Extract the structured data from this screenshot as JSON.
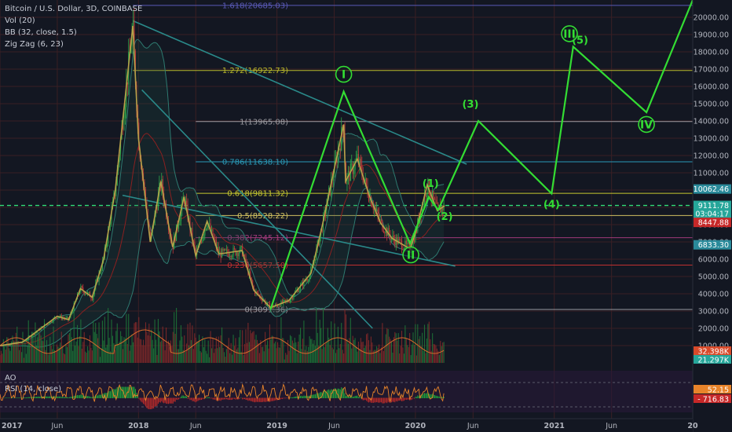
{
  "legend": {
    "title": "Bitcoin / U.S. Dollar, 3D, COINBASE",
    "vol": "Vol (20)",
    "bb": "BB (32, close, 1.5)",
    "zigzag": "Zig Zag (6, 23)"
  },
  "indicators": {
    "ao": "AO",
    "rsi": "RSI (14, close)"
  },
  "colors": {
    "background": "#131722",
    "grid": "#3a1f24",
    "wave": "#33dd33",
    "trend": "#2a8a8a",
    "bb": "#2e7a70",
    "ma": "#8b2020",
    "zigzag": "#b7a24a",
    "up": "#26a69a",
    "down": "#ef5350",
    "current": "#33dd77",
    "rsi": "#e8842a",
    "axis_text": "#b2b5be"
  },
  "chart_data": {
    "type": "candlestick",
    "symbol": "Bitcoin / U.S. Dollar",
    "interval": "3D",
    "exchange": "COINBASE",
    "price_axis": {
      "min": 0,
      "max": 21000,
      "ticks": [
        "1000.00",
        "2000.00",
        "3000.00",
        "4000.00",
        "5000.00",
        "6000.00",
        "7000.00",
        "8000.00",
        "9000.00",
        "10000.00",
        "11000.00",
        "12000.00",
        "13000.00",
        "14000.00",
        "15000.00",
        "16000.00",
        "17000.00",
        "18000.00",
        "19000.00",
        "20000.00"
      ]
    },
    "time_axis": {
      "start": "2017-01",
      "end": "2022-01",
      "ticks": [
        {
          "label": "2017",
          "date": "2017-01"
        },
        {
          "label": "Jun",
          "date": "2017-06"
        },
        {
          "label": "2018",
          "date": "2018-01"
        },
        {
          "label": "Jun",
          "date": "2018-06"
        },
        {
          "label": "2019",
          "date": "2019-01"
        },
        {
          "label": "Jun",
          "date": "2019-06"
        },
        {
          "label": "2020",
          "date": "2020-01"
        },
        {
          "label": "Jun",
          "date": "2020-06"
        },
        {
          "label": "2021",
          "date": "2021-01"
        },
        {
          "label": "Jun",
          "date": "2021-06"
        },
        {
          "label": "20",
          "date": "2022-01"
        }
      ]
    },
    "price_path": [
      [
        "2017-01",
        1000
      ],
      [
        "2017-03",
        1200
      ],
      [
        "2017-05",
        2200
      ],
      [
        "2017-06",
        2700
      ],
      [
        "2017-07",
        2500
      ],
      [
        "2017-08",
        4300
      ],
      [
        "2017-09",
        3800
      ],
      [
        "2017-10",
        6000
      ],
      [
        "2017-11",
        10000
      ],
      [
        "2017-12-17",
        19500
      ],
      [
        "2018-01",
        13000
      ],
      [
        "2018-02",
        7000
      ],
      [
        "2018-03",
        10500
      ],
      [
        "2018-04",
        6700
      ],
      [
        "2018-05",
        9600
      ],
      [
        "2018-06",
        6200
      ],
      [
        "2018-07",
        8200
      ],
      [
        "2018-08",
        6300
      ],
      [
        "2018-10",
        6500
      ],
      [
        "2018-11",
        4200
      ],
      [
        "2018-12-15",
        3200
      ],
      [
        "2019-02",
        3600
      ],
      [
        "2019-04",
        5200
      ],
      [
        "2019-05",
        8000
      ],
      [
        "2019-06-26",
        13800
      ],
      [
        "2019-07",
        10500
      ],
      [
        "2019-08",
        11800
      ],
      [
        "2019-09",
        9700
      ],
      [
        "2019-10",
        8100
      ],
      [
        "2019-11",
        7200
      ],
      [
        "2019-12-18",
        6600
      ],
      [
        "2020-01",
        7500
      ],
      [
        "2020-02",
        10300
      ],
      [
        "2020-02-28",
        8800
      ],
      [
        "2020-03-18",
        9100
      ]
    ],
    "fib_levels": [
      {
        "label": "1.618(20685.03)",
        "price": 20685.03,
        "color": "#5a5ab8"
      },
      {
        "label": "1.272(16922.73)",
        "price": 16922.73,
        "color": "#b8b82a"
      },
      {
        "label": "1(13965.08)",
        "price": 13965.08,
        "color": "#9a9aa0"
      },
      {
        "label": "0.786(11638.10)",
        "price": 11638.1,
        "color": "#2a9ab8"
      },
      {
        "label": "0.618(9811.32)",
        "price": 9811.32,
        "color": "#c8c830"
      },
      {
        "label": "0.5(8528.22)",
        "price": 8528.22,
        "color": "#d0c060"
      },
      {
        "label": "0.382(7245.12)",
        "price": 7245.12,
        "color": "#a03a7a"
      },
      {
        "label": "0.236(5657.50)",
        "price": 5657.5,
        "color": "#c03030"
      },
      {
        "label": "0(3091.36)",
        "price": 3091.36,
        "color": "#9a9aa0"
      }
    ],
    "price_tags": [
      {
        "label": "10062.46",
        "price": 10062.46,
        "bg": "#2a8a9a"
      },
      {
        "label": "9111.78",
        "price": 9111.78,
        "bg": "#26a69a"
      },
      {
        "label": "03:04:17",
        "price": 8640,
        "bg": "#26a69a"
      },
      {
        "label": "8447.88",
        "price": 8130,
        "bg": "#c62828"
      },
      {
        "label": "6833.30",
        "price": 6833.3,
        "bg": "#2a8a9a"
      }
    ],
    "current_price": 9111.78,
    "wave_path": [
      [
        "2018-12-15",
        3100
      ],
      [
        "2019-06-26",
        15700
      ],
      [
        "2019-12-18",
        6900
      ],
      [
        "2020-02-05",
        9600
      ],
      [
        "2020-03-01",
        8850
      ],
      [
        "2020-06-15",
        14000
      ],
      [
        "2020-12-25",
        9800
      ],
      [
        "2021-02-20",
        18300
      ],
      [
        "2021-09-01",
        14500
      ],
      [
        "2022-01",
        21000
      ]
    ],
    "wave_labels": [
      {
        "text": "I",
        "date": "2019-06-26",
        "price": 16700,
        "circled": true
      },
      {
        "text": "II",
        "date": "2019-12-20",
        "price": 6250,
        "circled": true
      },
      {
        "text": "(1)",
        "date": "2020-02-10",
        "price": 10400,
        "circled": false
      },
      {
        "text": "(2)",
        "date": "2020-03-18",
        "price": 8500,
        "circled": false
      },
      {
        "text": "(3)",
        "date": "2020-05-25",
        "price": 15000,
        "circled": false
      },
      {
        "text": "(4)",
        "date": "2020-12-25",
        "price": 9200,
        "circled": false
      },
      {
        "text": "(5)",
        "date": "2021-03-10",
        "price": 18700,
        "circled": false
      },
      {
        "text": "III",
        "date": "2021-02-10",
        "price": 19050,
        "circled": true
      },
      {
        "text": "IV",
        "date": "2021-09-01",
        "price": 13800,
        "circled": true
      }
    ],
    "trend_lines": [
      [
        [
          "2017-12-17",
          19800
        ],
        [
          "2020-05-15",
          11500
        ]
      ],
      [
        [
          "2017-11-20",
          9700
        ],
        [
          "2020-04-15",
          5600
        ]
      ],
      [
        [
          "2018-01-10",
          15800
        ],
        [
          "2019-09-10",
          2000
        ]
      ]
    ],
    "volume_axis": {
      "tags": [
        {
          "label": "32.398K",
          "bg": "#d84a2a"
        },
        {
          "label": "21.297K",
          "bg": "#26a69a"
        }
      ]
    },
    "indicator_axis": {
      "tags": [
        {
          "label": "52.15",
          "bg": "#e8842a"
        },
        {
          "label": "- 716.83",
          "bg": "#c62828"
        }
      ]
    }
  }
}
